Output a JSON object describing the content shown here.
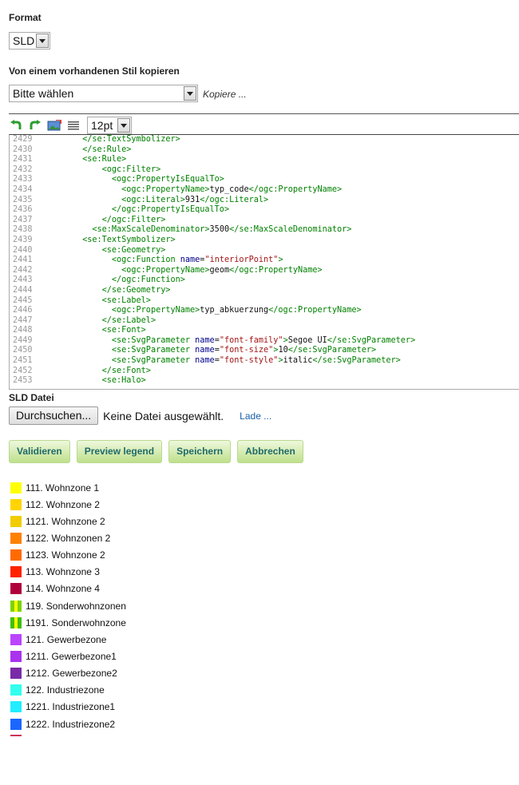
{
  "format": {
    "label": "Format",
    "selected": "SLD"
  },
  "copy": {
    "label": "Von einem vorhandenen Stil kopieren",
    "selected": "Bitte wählen",
    "action": "Kopiere ..."
  },
  "toolbar": {
    "font_size": "12pt",
    "icons": [
      "undo-icon",
      "redo-icon",
      "image-icon",
      "list-icon"
    ]
  },
  "editor": {
    "lines": [
      {
        "num": "2429",
        "indent": 8,
        "parts": [
          [
            "tag",
            "</se:TextSymbolizer>"
          ]
        ]
      },
      {
        "num": "2430",
        "indent": 8,
        "parts": [
          [
            "tag",
            "</se:Rule>"
          ]
        ]
      },
      {
        "num": "2431",
        "indent": 8,
        "parts": [
          [
            "tag",
            "<se:Rule>"
          ]
        ]
      },
      {
        "num": "2432",
        "indent": 12,
        "parts": [
          [
            "tag",
            "<ogc:Filter>"
          ]
        ]
      },
      {
        "num": "2433",
        "indent": 14,
        "parts": [
          [
            "tag",
            "<ogc:PropertyIsEqualTo>"
          ]
        ]
      },
      {
        "num": "2434",
        "indent": 16,
        "parts": [
          [
            "tag",
            "<ogc:PropertyName>"
          ],
          [
            "tx",
            "typ_code"
          ],
          [
            "tag",
            "</ogc:PropertyName>"
          ]
        ]
      },
      {
        "num": "2435",
        "indent": 16,
        "parts": [
          [
            "tag",
            "<ogc:Literal>"
          ],
          [
            "tx",
            "931"
          ],
          [
            "tag",
            "</ogc:Literal>"
          ]
        ]
      },
      {
        "num": "2436",
        "indent": 14,
        "parts": [
          [
            "tag",
            "</ogc:PropertyIsEqualTo>"
          ]
        ]
      },
      {
        "num": "2437",
        "indent": 12,
        "parts": [
          [
            "tag",
            "</ogc:Filter>"
          ]
        ]
      },
      {
        "num": "2438",
        "indent": 10,
        "parts": [
          [
            "tag",
            "<se:MaxScaleDenominator>"
          ],
          [
            "tx",
            "3500"
          ],
          [
            "tag",
            "</se:MaxScaleDenominator>"
          ]
        ]
      },
      {
        "num": "2439",
        "indent": 8,
        "parts": [
          [
            "tag",
            "<se:TextSymbolizer>"
          ]
        ]
      },
      {
        "num": "2440",
        "indent": 12,
        "parts": [
          [
            "tag",
            "<se:Geometry>"
          ]
        ]
      },
      {
        "num": "2441",
        "indent": 14,
        "parts": [
          [
            "tag",
            "<ogc:Function "
          ],
          [
            "attr",
            "name"
          ],
          [
            "tx",
            "="
          ],
          [
            "str",
            "\"interiorPoint\""
          ],
          [
            "tag",
            ">"
          ]
        ]
      },
      {
        "num": "2442",
        "indent": 16,
        "parts": [
          [
            "tag",
            "<ogc:PropertyName>"
          ],
          [
            "tx",
            "geom"
          ],
          [
            "tag",
            "</ogc:PropertyName>"
          ]
        ]
      },
      {
        "num": "2443",
        "indent": 14,
        "parts": [
          [
            "tag",
            "</ogc:Function>"
          ]
        ]
      },
      {
        "num": "2444",
        "indent": 12,
        "parts": [
          [
            "tag",
            "</se:Geometry>"
          ]
        ]
      },
      {
        "num": "2445",
        "indent": 12,
        "parts": [
          [
            "tag",
            "<se:Label>"
          ]
        ]
      },
      {
        "num": "2446",
        "indent": 14,
        "parts": [
          [
            "tag",
            "<ogc:PropertyName>"
          ],
          [
            "tx",
            "typ_abkuerzung"
          ],
          [
            "tag",
            "</ogc:PropertyName>"
          ]
        ]
      },
      {
        "num": "2447",
        "indent": 12,
        "parts": [
          [
            "tag",
            "</se:Label>"
          ]
        ]
      },
      {
        "num": "2448",
        "indent": 12,
        "parts": [
          [
            "tag",
            "<se:Font>"
          ]
        ]
      },
      {
        "num": "2449",
        "indent": 14,
        "parts": [
          [
            "tag",
            "<se:SvgParameter "
          ],
          [
            "attr",
            "name"
          ],
          [
            "tx",
            "="
          ],
          [
            "str",
            "\"font-family\""
          ],
          [
            "tag",
            ">"
          ],
          [
            "tx",
            "Segoe UI"
          ],
          [
            "tag",
            "</se:SvgParameter>"
          ]
        ]
      },
      {
        "num": "2450",
        "indent": 14,
        "parts": [
          [
            "tag",
            "<se:SvgParameter "
          ],
          [
            "attr",
            "name"
          ],
          [
            "tx",
            "="
          ],
          [
            "str",
            "\"font-size\""
          ],
          [
            "tag",
            ">"
          ],
          [
            "tx",
            "10"
          ],
          [
            "tag",
            "</se:SvgParameter>"
          ]
        ]
      },
      {
        "num": "2451",
        "indent": 14,
        "parts": [
          [
            "tag",
            "<se:SvgParameter "
          ],
          [
            "attr",
            "name"
          ],
          [
            "tx",
            "="
          ],
          [
            "str",
            "\"font-style\""
          ],
          [
            "tag",
            ">"
          ],
          [
            "tx",
            "italic"
          ],
          [
            "tag",
            "</se:SvgParameter>"
          ]
        ]
      },
      {
        "num": "2452",
        "indent": 12,
        "parts": [
          [
            "tag",
            "</se:Font>"
          ]
        ]
      },
      {
        "num": "2453",
        "indent": 12,
        "parts": [
          [
            "tag",
            "<se:Halo>"
          ]
        ]
      }
    ]
  },
  "sld_file": {
    "label": "SLD Datei",
    "browse": "Durchsuchen...",
    "status": "Keine Datei ausgewählt.",
    "load": "Lade ..."
  },
  "buttons": {
    "validate": "Validieren",
    "preview": "Preview legend",
    "save": "Speichern",
    "cancel": "Abbrechen"
  },
  "legend": [
    {
      "label": "111. Wohnzone 1",
      "color": "#ffff00"
    },
    {
      "label": "112. Wohnzone 2",
      "color": "#ffd400"
    },
    {
      "label": "1121. Wohnzone 2",
      "color": "#f2cc00"
    },
    {
      "label": "1122. Wohnzonen 2",
      "color": "#ff8000"
    },
    {
      "label": "1123. Wohnzone 2",
      "color": "#ff6a00"
    },
    {
      "label": "113. Wohnzone 3",
      "color": "#ff2200"
    },
    {
      "label": "114. Wohnzone 4",
      "color": "#b0003a"
    },
    {
      "label": "119. Sonderwohnzonen",
      "color": "#7cd400",
      "color2": "#ffff00"
    },
    {
      "label": "1191. Sonderwohnzone",
      "color": "#40c000",
      "color2": "#ffff00"
    },
    {
      "label": "121. Gewerbezone",
      "color": "#bb44ff"
    },
    {
      "label": "1211. Gewerbezone1",
      "color": "#aa33ee"
    },
    {
      "label": "1212. Gewerbezone2",
      "color": "#7a2aa8"
    },
    {
      "label": "122. Industriezone",
      "color": "#33ffee"
    },
    {
      "label": "1221. Industriezone1",
      "color": "#22eeff"
    },
    {
      "label": "1222. Industriezone2",
      "color": "#1a66ff"
    }
  ]
}
